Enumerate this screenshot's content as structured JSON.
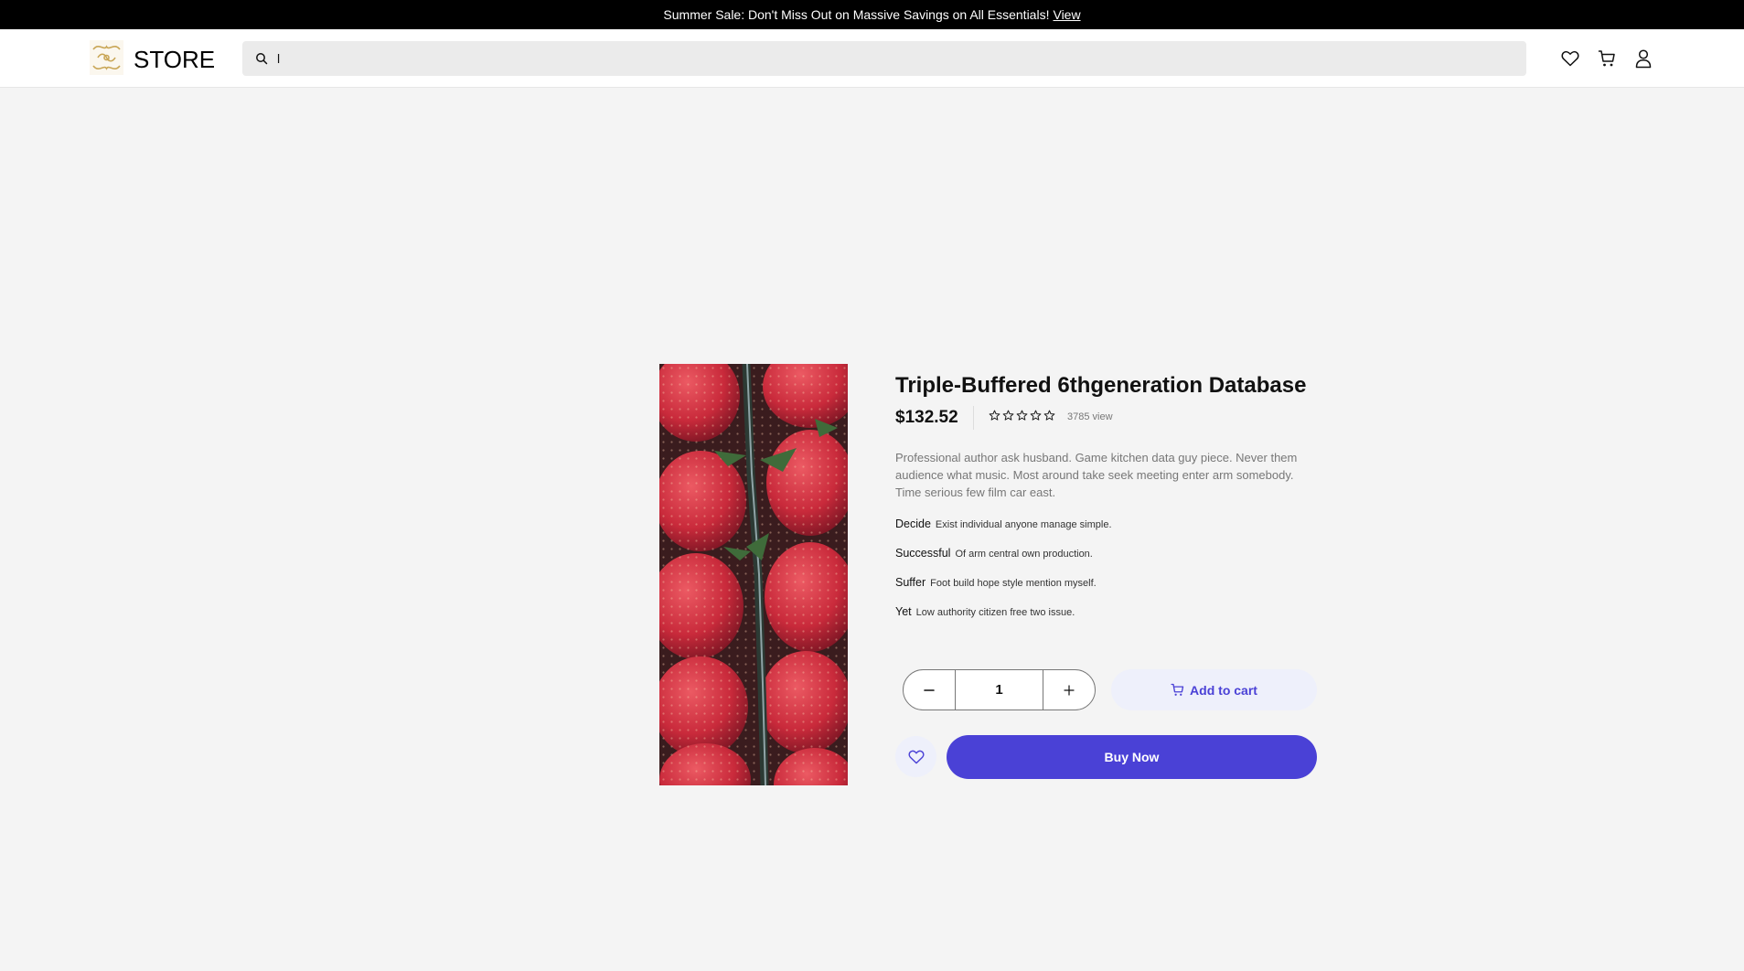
{
  "promo": {
    "text": "Summer Sale: Don't Miss Out on Massive Savings on All Essentials!",
    "link": "View"
  },
  "header": {
    "brand": "STORE",
    "search_value": "l",
    "icons": [
      "heart-icon",
      "cart-icon",
      "user-icon"
    ]
  },
  "product": {
    "title": "Triple-Buffered 6thgeneration Database",
    "price": "$132.52",
    "rating": 0,
    "rating_max": 5,
    "views": "3785 view",
    "description": "Professional author ask husband. Game kitchen data guy piece. Never them audience what music. Most around take seek meeting enter arm somebody. Time serious few film car east.",
    "features": [
      {
        "label": "Decide",
        "value": "Exist individual anyone manage simple."
      },
      {
        "label": "Successful",
        "value": "Of arm central own production."
      },
      {
        "label": "Suffer",
        "value": "Foot build hope style mention myself."
      },
      {
        "label": "Yet",
        "value": "Low authority citizen free two issue."
      }
    ],
    "quantity": "1",
    "add_to_cart": "Add to cart",
    "buy_now": "Buy Now"
  },
  "colors": {
    "accent": "#4a41d6",
    "accent_soft": "#eef0fb",
    "promo_bg": "#000000",
    "page_bg": "#f4f4f4"
  }
}
